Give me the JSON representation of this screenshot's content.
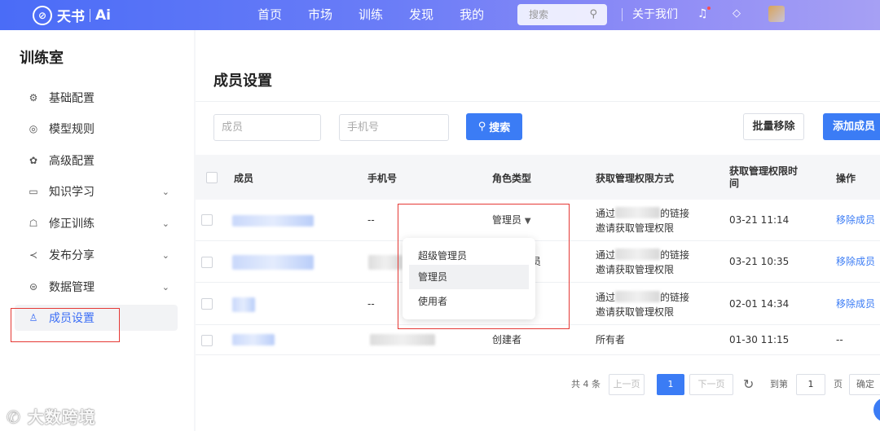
{
  "brand": {
    "mark": "⊘",
    "name": "天书",
    "suffix": "Ai"
  },
  "nav": [
    "首页",
    "市场",
    "训练",
    "发现",
    "我的"
  ],
  "search": {
    "placeholder": "搜索"
  },
  "about": "关于我们",
  "icons": {
    "search": "search-icon",
    "bell": "bell-icon",
    "gem": "diamond-icon"
  },
  "sidebar": {
    "title": "训练室",
    "items": [
      {
        "label": "基础配置",
        "icon": "⚙",
        "chevron": false
      },
      {
        "label": "模型规则",
        "icon": "◎",
        "chevron": false
      },
      {
        "label": "高级配置",
        "icon": "✿",
        "chevron": false
      },
      {
        "label": "知识学习",
        "icon": "▭",
        "chevron": true
      },
      {
        "label": "修正训练",
        "icon": "☖",
        "chevron": true
      },
      {
        "label": "发布分享",
        "icon": "≺",
        "chevron": true
      },
      {
        "label": "数据管理",
        "icon": "⊜",
        "chevron": true
      },
      {
        "label": "成员设置",
        "icon": "♙",
        "chevron": false,
        "active": true
      }
    ]
  },
  "watermark": "大数跨境",
  "main": {
    "title": "成员设置",
    "filters": {
      "member_placeholder": "成员",
      "phone_placeholder": "手机号"
    },
    "search_button": "搜索",
    "batch_remove": "批量移除",
    "add_member": "添加成员",
    "columns": [
      "成员",
      "手机号",
      "角色类型",
      "获取管理权限方式",
      "获取管理权限时间",
      "操作"
    ],
    "rows": [
      {
        "member": "",
        "phone": "--",
        "role": "管理员",
        "method_1": "通过",
        "method_2": "的链接",
        "method_3": "邀请获取管理权限",
        "time": "03-21 11:14",
        "action": "移除成员"
      },
      {
        "member": "",
        "phone": "",
        "role": "员",
        "method_1": "通过",
        "method_2": "的链接",
        "method_3": "邀请获取管理权限",
        "time": "03-21 10:35",
        "action": "移除成员"
      },
      {
        "member": "",
        "phone": "--",
        "role": "",
        "method_1": "通过",
        "method_2": "的链接",
        "method_3": "邀请获取管理权限",
        "time": "02-01 14:34",
        "action": "移除成员"
      },
      {
        "member": "",
        "phone": "",
        "role": "创建者",
        "method_1": "所有者",
        "method_2": "",
        "method_3": "",
        "time": "01-30 11:15",
        "action": "--"
      }
    ],
    "role_dropdown": [
      "超级管理员",
      "管理员",
      "使用者"
    ],
    "pagination": {
      "total": "共 4 条",
      "prev": "上一页",
      "current": "1",
      "next": "下一页",
      "goto": "到第",
      "page_value": "1",
      "page_unit": "页",
      "confirm": "确定"
    }
  }
}
